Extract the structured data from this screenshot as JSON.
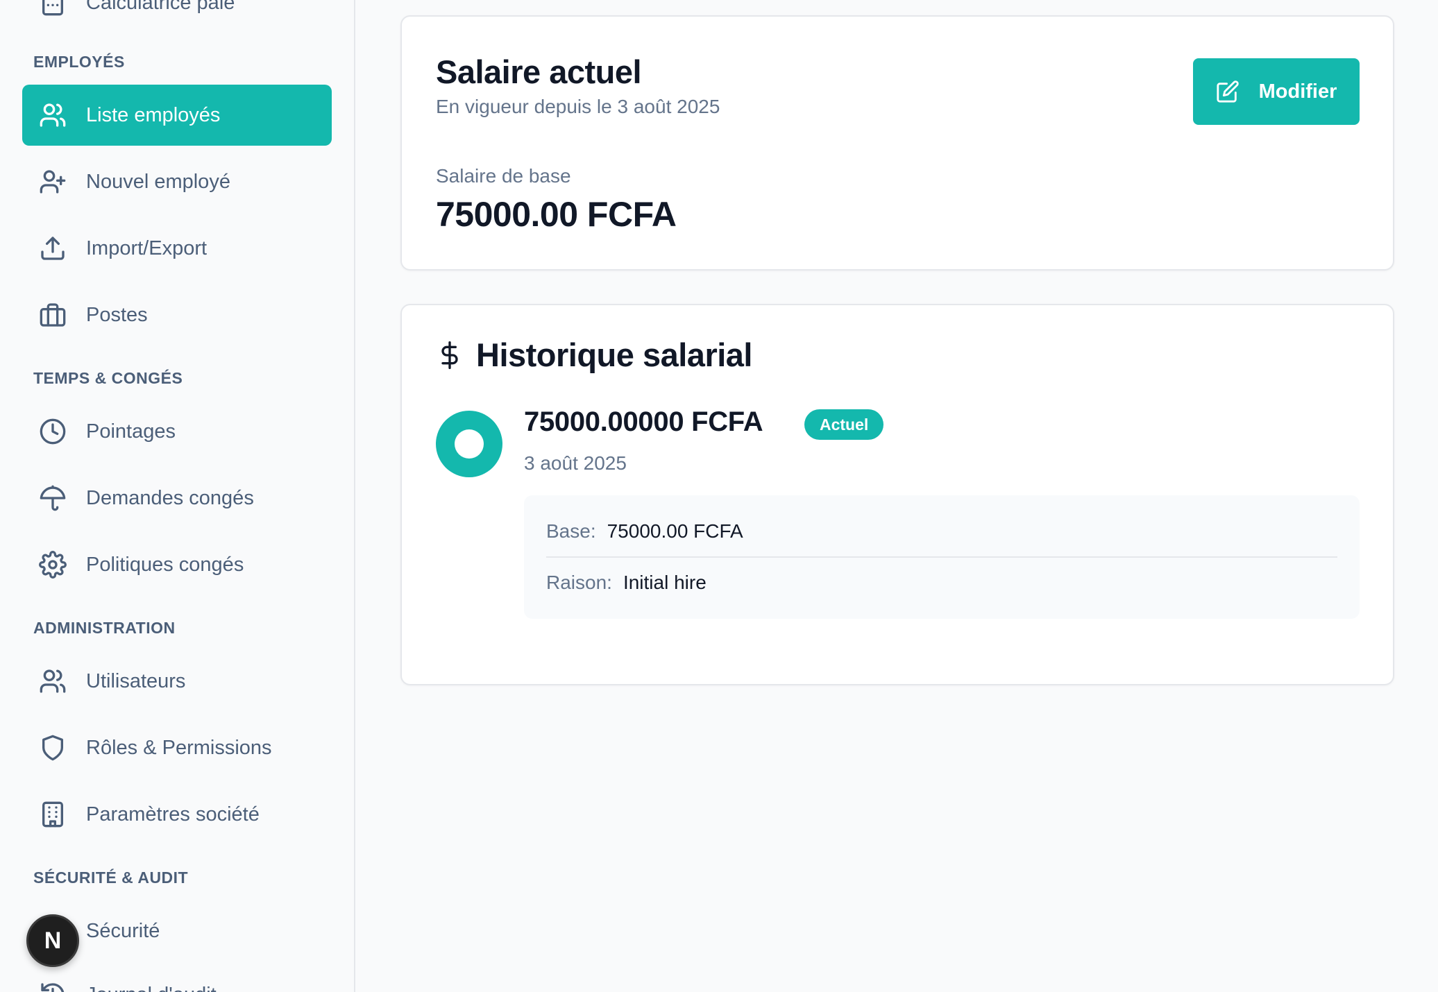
{
  "sidebar": {
    "top_item": {
      "label": "Calculatrice paie",
      "icon": "calculator-icon"
    },
    "sections": [
      {
        "title": "EMPLOYÉS"
      },
      {
        "title": "TEMPS & CONGÉS"
      },
      {
        "title": "ADMINISTRATION"
      },
      {
        "title": "SÉCURITÉ & AUDIT"
      }
    ],
    "items": [
      {
        "label": "Liste employés",
        "icon": "users-icon",
        "active": true
      },
      {
        "label": "Nouvel employé",
        "icon": "user-plus-icon"
      },
      {
        "label": "Import/Export",
        "icon": "upload-icon"
      },
      {
        "label": "Postes",
        "icon": "briefcase-icon"
      },
      {
        "label": "Pointages",
        "icon": "clock-icon"
      },
      {
        "label": "Demandes congés",
        "icon": "umbrella-icon"
      },
      {
        "label": "Politiques congés",
        "icon": "gear-icon"
      },
      {
        "label": "Utilisateurs",
        "icon": "users-icon"
      },
      {
        "label": "Rôles & Permissions",
        "icon": "shield-icon"
      },
      {
        "label": "Paramètres société",
        "icon": "building-icon"
      },
      {
        "label": "Sécurité",
        "icon": "lock-icon"
      },
      {
        "label": "Journal d'audit",
        "icon": "history-icon"
      }
    ]
  },
  "avatar": {
    "letter": "N"
  },
  "current_salary": {
    "title": "Salaire actuel",
    "subtitle": "En vigueur depuis le 3 août 2025",
    "base_label": "Salaire de base",
    "base_amount": "75000.00 FCFA",
    "edit_button": "Modifier"
  },
  "history": {
    "title": "Historique salarial",
    "entries": [
      {
        "amount": "75000.00000 FCFA",
        "badge": "Actuel",
        "date": "3 août 2025",
        "base_key": "Base:",
        "base_value": "75000.00 FCFA",
        "reason_key": "Raison:",
        "reason_value": "Initial hire"
      }
    ]
  },
  "colors": {
    "accent": "#14b8ad",
    "muted": "#64748b",
    "text": "#111827"
  }
}
